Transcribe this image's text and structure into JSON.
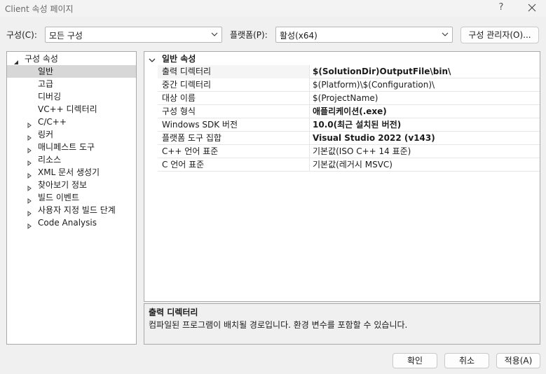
{
  "window": {
    "title": "Client 속성 페이지",
    "help": "?"
  },
  "toolbar": {
    "config_label": "구성(C):",
    "config_value": "모든 구성",
    "platform_label": "플랫폼(P):",
    "platform_value": "활성(x64)",
    "config_manager_button": "구성 관리자(O)..."
  },
  "tree": {
    "root": "구성 속성",
    "items": [
      {
        "label": "일반",
        "expandable": false,
        "selected": true
      },
      {
        "label": "고급",
        "expandable": false
      },
      {
        "label": "디버깅",
        "expandable": false
      },
      {
        "label": "VC++ 디렉터리",
        "expandable": false
      },
      {
        "label": "C/C++",
        "expandable": true
      },
      {
        "label": "링커",
        "expandable": true
      },
      {
        "label": "매니페스트 도구",
        "expandable": true
      },
      {
        "label": "리소스",
        "expandable": true
      },
      {
        "label": "XML 문서 생성기",
        "expandable": true
      },
      {
        "label": "찾아보기 정보",
        "expandable": true
      },
      {
        "label": "빌드 이벤트",
        "expandable": true
      },
      {
        "label": "사용자 지정 빌드 단계",
        "expandable": true
      },
      {
        "label": "Code Analysis",
        "expandable": true
      }
    ]
  },
  "grid": {
    "category": "일반 속성",
    "properties": [
      {
        "name": "출력 디렉터리",
        "value": "$(SolutionDir)OutputFile\\bin\\",
        "bold": true
      },
      {
        "name": "중간 디렉터리",
        "value": "$(Platform)\\$(Configuration)\\",
        "bold": false
      },
      {
        "name": "대상 이름",
        "value": "$(ProjectName)",
        "bold": false
      },
      {
        "name": "구성 형식",
        "value": "애플리케이션(.exe)",
        "bold": true
      },
      {
        "name": "Windows SDK 버전",
        "value": "10.0(최근 설치된 버전)",
        "bold": true
      },
      {
        "name": "플랫폼 도구 집합",
        "value": "Visual Studio 2022 (v143)",
        "bold": true
      },
      {
        "name": "C++ 언어 표준",
        "value": "기본값(ISO C++ 14 표준)",
        "bold": false
      },
      {
        "name": "C 언어 표준",
        "value": "기본값(레거시 MSVC)",
        "bold": false
      }
    ]
  },
  "description": {
    "title": "출력 디렉터리",
    "text": "컴파일된 프로그램이 배치될 경로입니다. 환경 변수를 포함할 수 있습니다."
  },
  "footer": {
    "ok": "확인",
    "cancel": "취소",
    "apply": "적용(A)"
  }
}
